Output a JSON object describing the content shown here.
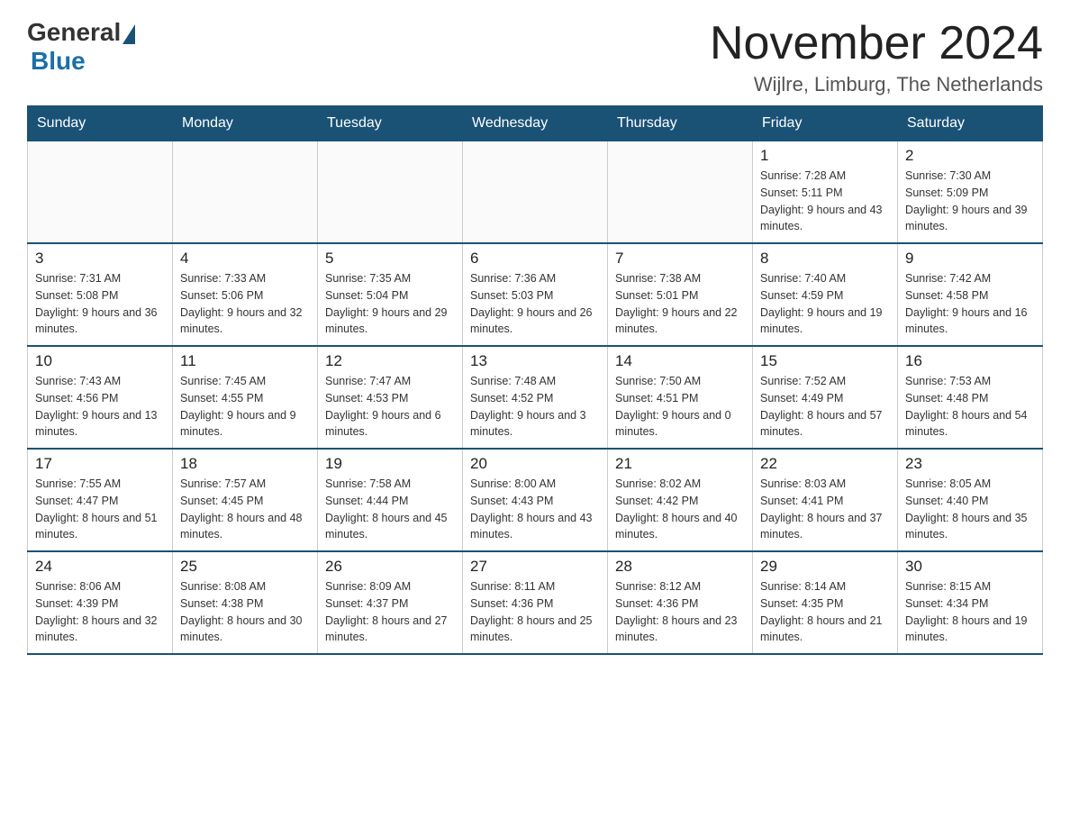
{
  "logo": {
    "general": "General",
    "blue": "Blue"
  },
  "title": "November 2024",
  "location": "Wijlre, Limburg, The Netherlands",
  "weekdays": [
    "Sunday",
    "Monday",
    "Tuesday",
    "Wednesday",
    "Thursday",
    "Friday",
    "Saturday"
  ],
  "weeks": [
    [
      {
        "day": "",
        "info": ""
      },
      {
        "day": "",
        "info": ""
      },
      {
        "day": "",
        "info": ""
      },
      {
        "day": "",
        "info": ""
      },
      {
        "day": "",
        "info": ""
      },
      {
        "day": "1",
        "info": "Sunrise: 7:28 AM\nSunset: 5:11 PM\nDaylight: 9 hours and 43 minutes."
      },
      {
        "day": "2",
        "info": "Sunrise: 7:30 AM\nSunset: 5:09 PM\nDaylight: 9 hours and 39 minutes."
      }
    ],
    [
      {
        "day": "3",
        "info": "Sunrise: 7:31 AM\nSunset: 5:08 PM\nDaylight: 9 hours and 36 minutes."
      },
      {
        "day": "4",
        "info": "Sunrise: 7:33 AM\nSunset: 5:06 PM\nDaylight: 9 hours and 32 minutes."
      },
      {
        "day": "5",
        "info": "Sunrise: 7:35 AM\nSunset: 5:04 PM\nDaylight: 9 hours and 29 minutes."
      },
      {
        "day": "6",
        "info": "Sunrise: 7:36 AM\nSunset: 5:03 PM\nDaylight: 9 hours and 26 minutes."
      },
      {
        "day": "7",
        "info": "Sunrise: 7:38 AM\nSunset: 5:01 PM\nDaylight: 9 hours and 22 minutes."
      },
      {
        "day": "8",
        "info": "Sunrise: 7:40 AM\nSunset: 4:59 PM\nDaylight: 9 hours and 19 minutes."
      },
      {
        "day": "9",
        "info": "Sunrise: 7:42 AM\nSunset: 4:58 PM\nDaylight: 9 hours and 16 minutes."
      }
    ],
    [
      {
        "day": "10",
        "info": "Sunrise: 7:43 AM\nSunset: 4:56 PM\nDaylight: 9 hours and 13 minutes."
      },
      {
        "day": "11",
        "info": "Sunrise: 7:45 AM\nSunset: 4:55 PM\nDaylight: 9 hours and 9 minutes."
      },
      {
        "day": "12",
        "info": "Sunrise: 7:47 AM\nSunset: 4:53 PM\nDaylight: 9 hours and 6 minutes."
      },
      {
        "day": "13",
        "info": "Sunrise: 7:48 AM\nSunset: 4:52 PM\nDaylight: 9 hours and 3 minutes."
      },
      {
        "day": "14",
        "info": "Sunrise: 7:50 AM\nSunset: 4:51 PM\nDaylight: 9 hours and 0 minutes."
      },
      {
        "day": "15",
        "info": "Sunrise: 7:52 AM\nSunset: 4:49 PM\nDaylight: 8 hours and 57 minutes."
      },
      {
        "day": "16",
        "info": "Sunrise: 7:53 AM\nSunset: 4:48 PM\nDaylight: 8 hours and 54 minutes."
      }
    ],
    [
      {
        "day": "17",
        "info": "Sunrise: 7:55 AM\nSunset: 4:47 PM\nDaylight: 8 hours and 51 minutes."
      },
      {
        "day": "18",
        "info": "Sunrise: 7:57 AM\nSunset: 4:45 PM\nDaylight: 8 hours and 48 minutes."
      },
      {
        "day": "19",
        "info": "Sunrise: 7:58 AM\nSunset: 4:44 PM\nDaylight: 8 hours and 45 minutes."
      },
      {
        "day": "20",
        "info": "Sunrise: 8:00 AM\nSunset: 4:43 PM\nDaylight: 8 hours and 43 minutes."
      },
      {
        "day": "21",
        "info": "Sunrise: 8:02 AM\nSunset: 4:42 PM\nDaylight: 8 hours and 40 minutes."
      },
      {
        "day": "22",
        "info": "Sunrise: 8:03 AM\nSunset: 4:41 PM\nDaylight: 8 hours and 37 minutes."
      },
      {
        "day": "23",
        "info": "Sunrise: 8:05 AM\nSunset: 4:40 PM\nDaylight: 8 hours and 35 minutes."
      }
    ],
    [
      {
        "day": "24",
        "info": "Sunrise: 8:06 AM\nSunset: 4:39 PM\nDaylight: 8 hours and 32 minutes."
      },
      {
        "day": "25",
        "info": "Sunrise: 8:08 AM\nSunset: 4:38 PM\nDaylight: 8 hours and 30 minutes."
      },
      {
        "day": "26",
        "info": "Sunrise: 8:09 AM\nSunset: 4:37 PM\nDaylight: 8 hours and 27 minutes."
      },
      {
        "day": "27",
        "info": "Sunrise: 8:11 AM\nSunset: 4:36 PM\nDaylight: 8 hours and 25 minutes."
      },
      {
        "day": "28",
        "info": "Sunrise: 8:12 AM\nSunset: 4:36 PM\nDaylight: 8 hours and 23 minutes."
      },
      {
        "day": "29",
        "info": "Sunrise: 8:14 AM\nSunset: 4:35 PM\nDaylight: 8 hours and 21 minutes."
      },
      {
        "day": "30",
        "info": "Sunrise: 8:15 AM\nSunset: 4:34 PM\nDaylight: 8 hours and 19 minutes."
      }
    ]
  ]
}
